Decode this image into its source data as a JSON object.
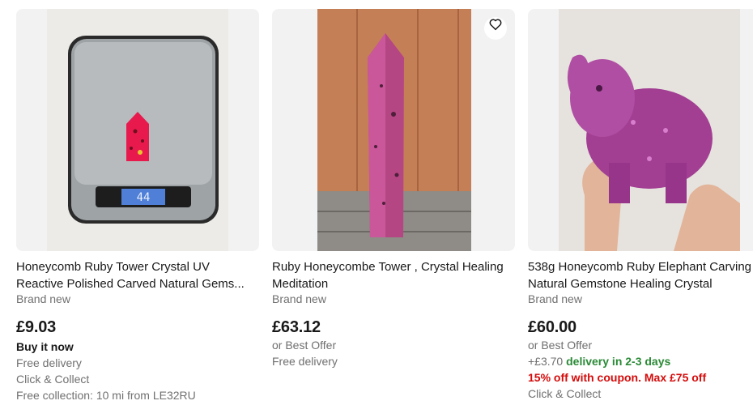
{
  "listings": [
    {
      "title_line1": "Honeycomb Ruby Tower Crystal UV",
      "title_line2": "Reactive Polished Carved Natural Gems...",
      "condition": "Brand new",
      "price": "£9.03",
      "buying_format": "Buy it now",
      "delivery": "Free delivery",
      "collect": "Click & Collect",
      "collection": "Free collection: 10 mi from LE32RU",
      "scale_reading": "44"
    },
    {
      "title_line1": "Ruby Honeycombe Tower , Crystal Healing",
      "title_line2": "Meditation",
      "condition": "Brand new",
      "price": "£63.12",
      "buying_format": "or Best Offer",
      "delivery": "Free delivery"
    },
    {
      "title_line1": "538g Honeycomb Ruby Elephant Carving",
      "title_line2": "Natural Gemstone Healing Crystal",
      "condition": "Brand new",
      "price": "£60.00",
      "buying_format": "or Best Offer",
      "shipping_cost": "+£3.70",
      "delivery_time": "delivery in 2-3 days",
      "coupon": "15% off with coupon. Max £75 off",
      "collect": "Click & Collect"
    }
  ],
  "colors": {
    "price_text": "#191919",
    "secondary_text": "#707070",
    "delivery_green": "#2a8a36",
    "coupon_red": "#d50b0b",
    "ruby_pink": "#c2357a"
  },
  "icons": {
    "favorite": "heart-outline-icon"
  }
}
